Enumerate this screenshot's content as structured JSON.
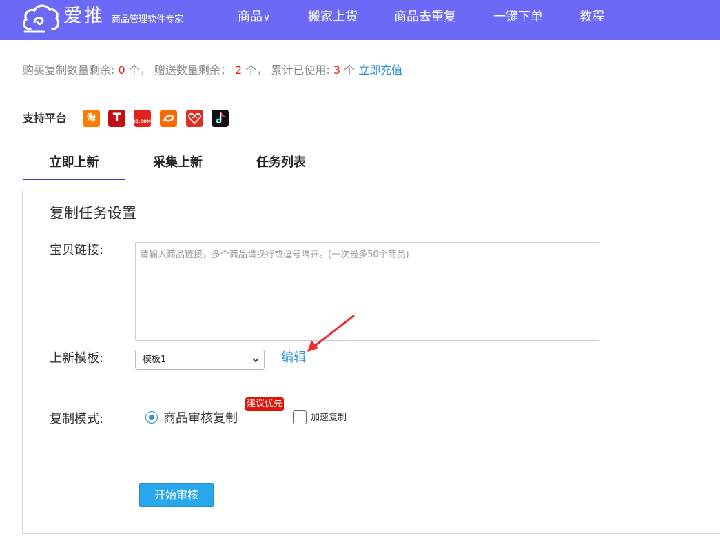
{
  "header": {
    "logo_name": "爱推",
    "logo_slogan": "商品管理软件专家",
    "nav": {
      "products": "商品",
      "products_caret": "∨",
      "move_goods": "搬家上货",
      "dedup": "商品去重复",
      "one_click_order": "一键下单",
      "tutorial": "教程"
    },
    "background_color": "#6b69f6"
  },
  "quota": {
    "purchase_label": "购买复制数量剩余:",
    "purchase_count": "0",
    "gift_label": "个， 赠送数量剩余：",
    "gift_count": "2",
    "used_label": "个， 累计已使用:",
    "used_count": "3",
    "unit": "个",
    "recharge": "立即充值"
  },
  "platforms": {
    "label": "支持平台",
    "items": [
      {
        "name": "taobao-icon",
        "glyph": "淘"
      },
      {
        "name": "tmall-icon",
        "glyph": "T"
      },
      {
        "name": "jd-icon",
        "glyph": "JD.COM"
      },
      {
        "name": "alibaba-icon",
        "glyph": ""
      },
      {
        "name": "pinduoduo-icon",
        "glyph": ""
      },
      {
        "name": "douyin-icon",
        "glyph": ""
      }
    ]
  },
  "tabs": {
    "now": "立即上新",
    "collect": "采集上新",
    "tasks": "任务列表",
    "active": "now"
  },
  "form": {
    "title": "复制任务设置",
    "link_label": "宝贝链接:",
    "link_placeholder": "请输入商品链接，多个商品请换行或逗号隔开。(一次最多50个商品)",
    "link_value": "",
    "template_label": "上新模板:",
    "template_selected": "模板1",
    "edit": "编辑",
    "mode_label": "复制模式:",
    "mode_option": "商品审核复制",
    "mode_selected": true,
    "badge": "建议优先",
    "speed_copy": "加速复制",
    "speed_checked": false,
    "start_button": "开始审核"
  },
  "colors": {
    "accent_link": "#2a8fd4",
    "danger_red": "#e1251b",
    "button_blue": "#28a7ec"
  }
}
